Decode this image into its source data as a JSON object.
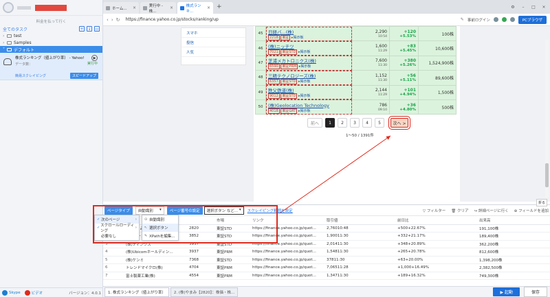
{
  "left_panel": {
    "subtitle": "料金を払って行く",
    "all_tasks_label": "全てのタスク",
    "groups": [
      {
        "name": "test"
      },
      {
        "name": "Samples"
      },
      {
        "name": "デフォルト"
      }
    ],
    "task": {
      "name": "株式ランキング（値上がり率） - Yahoo!フ...",
      "data_count": "データ数：",
      "status": "実行中",
      "type": "簡易スクレイピング",
      "speed_label": "スピードアップ"
    },
    "footer": {
      "skype": "Skype",
      "video": "ビデオ",
      "version": "バージョン：4.0.1"
    }
  },
  "browser": {
    "tabs": [
      {
        "label": "ホーム..."
      },
      {
        "label": "実行中 - 株..."
      },
      {
        "label": "株式ランキ..."
      }
    ],
    "url": "https://finance.yahoo.co.jp/stocks/ranking/up",
    "login_label": "事前ログイン",
    "pc_browser_label": "PCブラウザ"
  },
  "sidebar_links": [
    "スマホ",
    "投信",
    "人気"
  ],
  "ranking_rows": [
    {
      "rank": "45",
      "name": "日経バ...(株)",
      "code": "2218",
      "market": "東証",
      "board": "掲示板",
      "price": "2,290",
      "time": "10:54",
      "change": "+120",
      "pct": "+5.53%",
      "volume": "100株"
    },
    {
      "rank": "46",
      "name": "(株)ニッチツ",
      "code": "7021",
      "market": "東証STD",
      "board": "掲示板",
      "price": "1,600",
      "time": "11:29",
      "change": "+83",
      "pct": "+5.45%",
      "volume": "10,600株"
    },
    {
      "rank": "47",
      "name": "芝浦メカトロニクス(株)",
      "code": "6590",
      "market": "東証PRM",
      "board": "掲示板",
      "price": "7,600",
      "time": "11:30",
      "change": "+380",
      "pct": "+5.26%",
      "volume": "1,524,900株"
    },
    {
      "rank": "48",
      "name": "三精テクノロジーズ(株)",
      "code": "6357",
      "market": "東証STD",
      "board": "掲示板",
      "price": "1,152",
      "time": "11:30",
      "change": "+56",
      "pct": "+5.11%",
      "volume": "89,600株"
    },
    {
      "rank": "49",
      "name": "秩父鉄道(株)",
      "code": "9012",
      "market": "東証STD",
      "board": "掲示板",
      "price": "2,144",
      "time": "11:29",
      "change": "+101",
      "pct": "+4.94%",
      "volume": "1,500株"
    },
    {
      "rank": "50",
      "name": "(株)Geolocation Technology",
      "code": "4018",
      "market": "東証GRT",
      "board": "掲示板",
      "price": "786",
      "time": "09:10",
      "change": "+36",
      "pct": "+4.80%",
      "volume": "500株"
    }
  ],
  "pager": {
    "prev": "前へ",
    "pages": [
      "1",
      "2",
      "3",
      "4",
      "5"
    ],
    "next": "次へ >",
    "count": "1〜50 / 1391件"
  },
  "panel": {
    "page_type_btn": "ページタイプ",
    "auto_detect": "自動識別",
    "page_turn_btn": "ページ番号の設定",
    "select_btn": "選択ボタン など...",
    "scroll_link": "スクレイピング範囲を設定",
    "filter": "フィルター",
    "clear": "クリア",
    "detail": "詳細ページに行く",
    "add_field": "フィールドを追加",
    "collapse": "折る",
    "menu1": [
      "次のページ",
      "スクロールローディング",
      "必要なし"
    ],
    "menu2": [
      "自動識別",
      "選択ボタン",
      "XPathを編集..."
    ],
    "columns": [
      "順位",
      "名称",
      "",
      "市場",
      "リンク",
      "取引値",
      "",
      "前日比",
      "出来高"
    ],
    "rows": [
      [
        "1",
        "(株)やまみ",
        "2820",
        "東証STD",
        "https://finance.yahoo.co.jp/quot...",
        "2,76010:48",
        "",
        "+500+22.67%",
        "191,100株"
      ],
      [
        "2",
        "サイバーコム(株)",
        "3852",
        "東証STD",
        "https://finance.yahoo.co.jp/quot...",
        "1,90011:30",
        "",
        "+332+21.17%",
        "189,400株"
      ],
      [
        "3",
        "(株)ディンクス",
        "3937",
        "東証STD",
        "https://finance.yahoo.co.jp/quot...",
        "2,01411:30",
        "",
        "+348+20.89%",
        "362,200株"
      ],
      [
        "4",
        "(株)Ubicomホールディン...",
        "3937",
        "東証PRM",
        "https://finance.yahoo.co.jp/quot...",
        "1,54811:30",
        "",
        "+265+20.78%",
        "812,600株"
      ],
      [
        "5",
        "(株)ケンミ",
        "7368",
        "東証STD",
        "https://finance.yahoo.co.jp/quot...",
        "37811:30",
        "",
        "+63+20.00%",
        "1,398,200株"
      ],
      [
        "6",
        "トレンドマイクロ(株)",
        "4704",
        "東証PRM",
        "https://finance.yahoo.co.jp/quot...",
        "7,06511:28",
        "",
        "+1,000+16.49%",
        "2,382,500株"
      ],
      [
        "7",
        "富士製薬工業(株)",
        "4554",
        "東証PRM",
        "https://finance.yahoo.co.jp/quot...",
        "1,34711:30",
        "",
        "+189+16.32%",
        "749,300株"
      ]
    ]
  },
  "task_tabs": [
    "1. 株式ランキング（値上がり率）",
    "2. (株)やまみ【2820】：株価・株..."
  ],
  "start_label": "起動",
  "save_label": "保存"
}
